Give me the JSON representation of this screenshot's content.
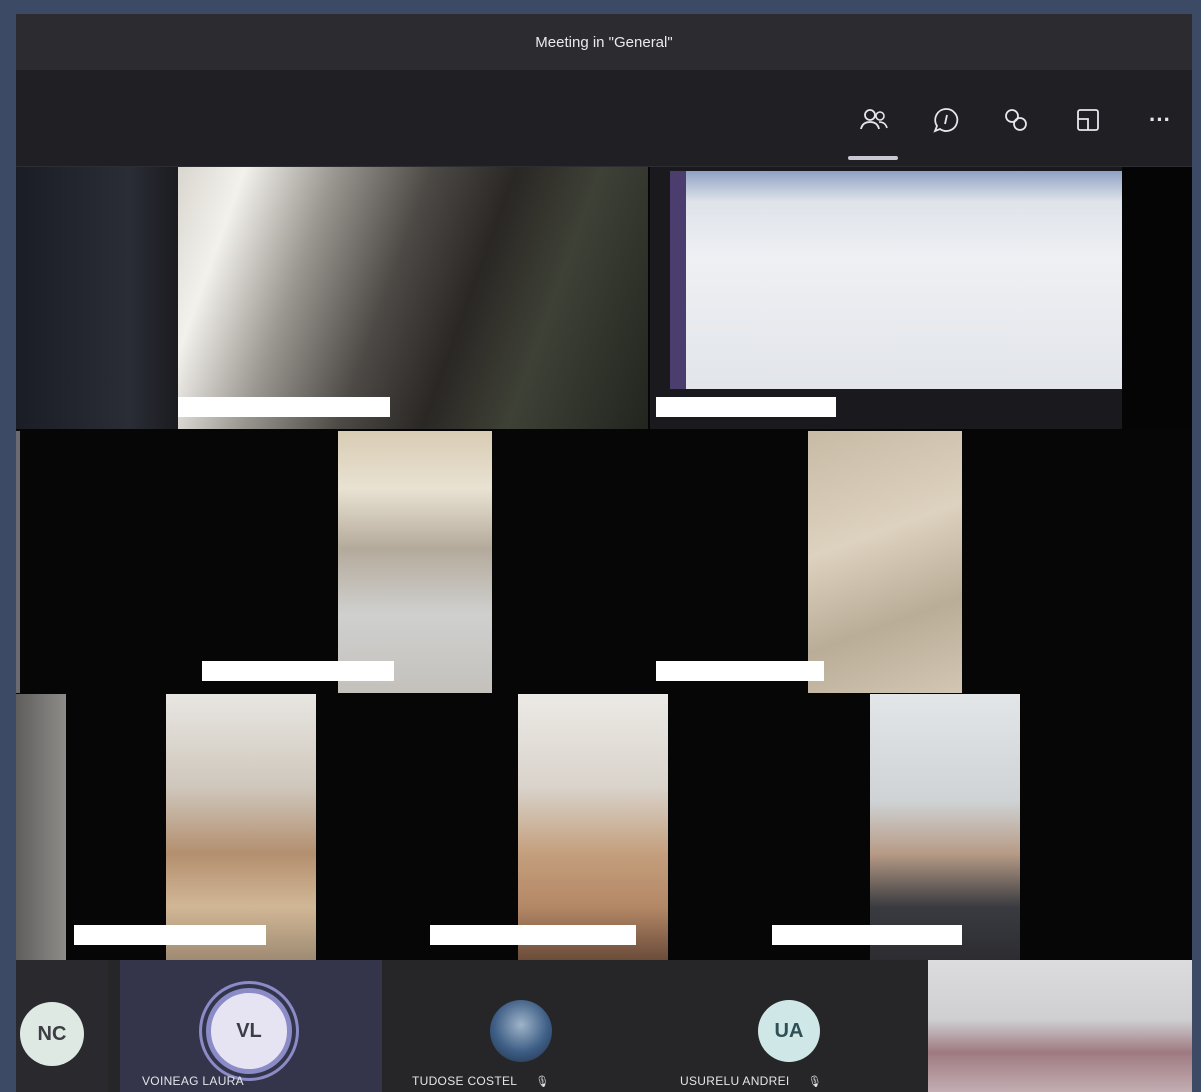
{
  "window": {
    "title": "Meeting in \"General\""
  },
  "toolbar": {
    "buttons": [
      {
        "icon": "participants-icon",
        "active": true
      },
      {
        "icon": "chat-icon"
      },
      {
        "icon": "breakout-rooms-icon"
      },
      {
        "icon": "share-tray-icon"
      },
      {
        "icon": "more-options-icon",
        "label": "···"
      }
    ]
  },
  "participants_strip": [
    {
      "initials": "NC",
      "name": ""
    },
    {
      "initials": "VL",
      "name": "VOINEAG LAURA",
      "speaking": true
    },
    {
      "initials": "",
      "name": "TUDOSE COSTEL",
      "has_photo": true
    },
    {
      "initials": "UA",
      "name": "USURELU ANDREI"
    }
  ],
  "colors": {
    "accent": "#6264a7",
    "avatar_bg": "#dfe9e4",
    "avatar_ua_bg": "#cfe7e6",
    "speaking_ring": "#8b8cc7"
  }
}
